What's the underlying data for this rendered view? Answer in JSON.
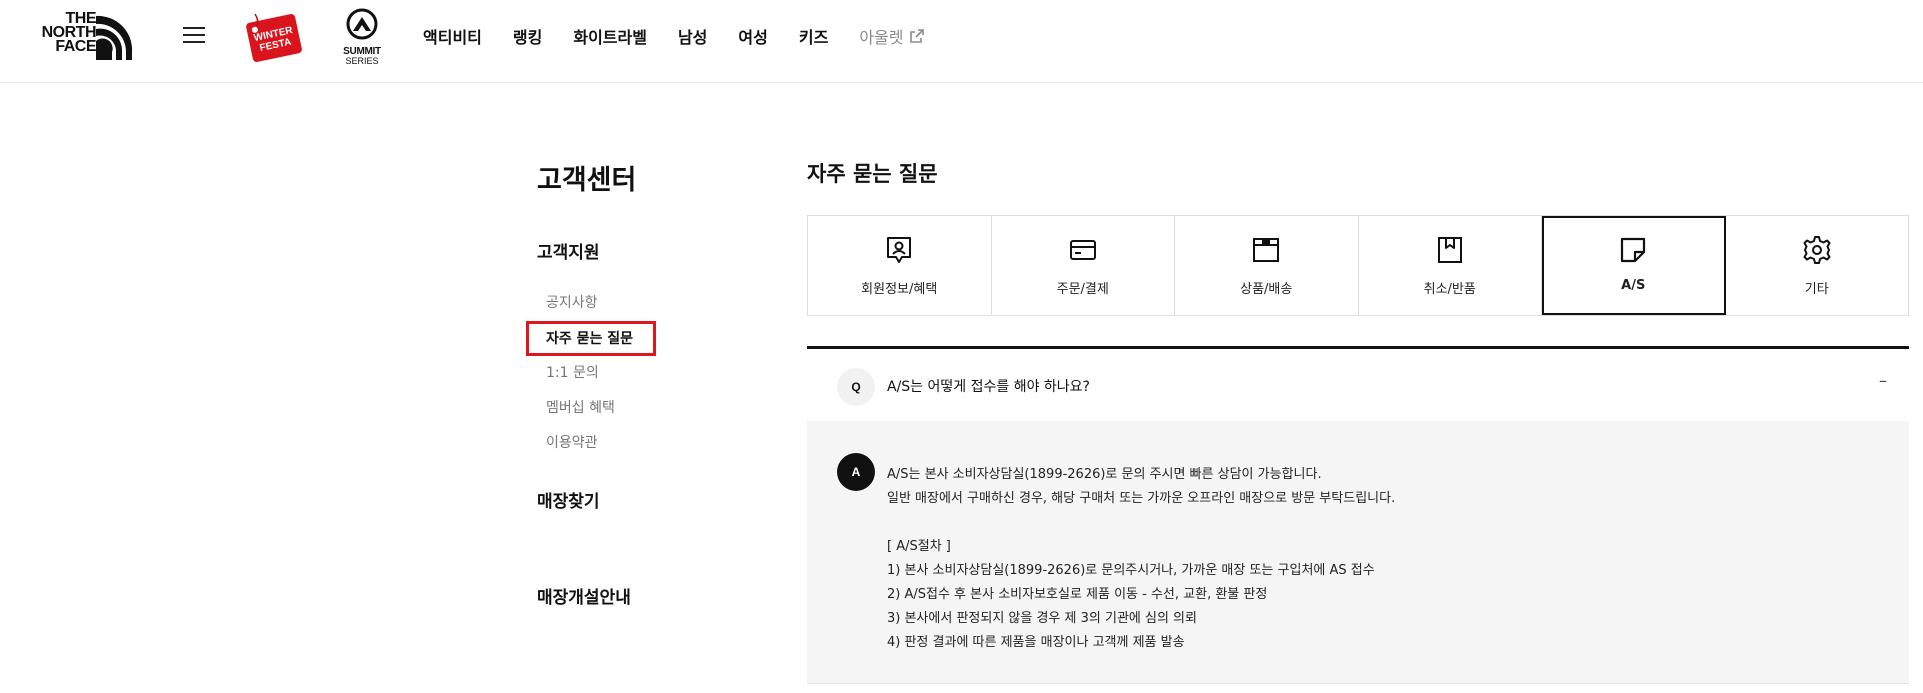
{
  "brand": {
    "logo_lines": [
      "THE",
      "NORTH",
      "FACE"
    ],
    "festa_badge": "WINTER FESTA",
    "summit_line1": "SUMMIT",
    "summit_line2": "SERIES"
  },
  "nav": {
    "items": [
      "액티비티",
      "랭킹",
      "화이트라벨",
      "남성",
      "여성",
      "키즈"
    ],
    "outlet": "아울렛"
  },
  "sidebar": {
    "title": "고객센터",
    "group_support": "고객지원",
    "links": [
      "공지사항",
      "자주 묻는 질문",
      "1:1 문의",
      "멤버십 혜택",
      "이용약관"
    ],
    "active_index": 1,
    "group_store": "매장찾기",
    "group_open": "매장개설안내"
  },
  "main": {
    "title": "자주 묻는 질문",
    "tabs": [
      {
        "label": "회원정보/혜택",
        "icon": "member-icon"
      },
      {
        "label": "주문/결제",
        "icon": "card-icon"
      },
      {
        "label": "상품/배송",
        "icon": "box-icon"
      },
      {
        "label": "취소/반품",
        "icon": "return-icon"
      },
      {
        "label": "A/S",
        "icon": "note-icon"
      },
      {
        "label": "기타",
        "icon": "gear-icon"
      }
    ],
    "active_tab": "A/S"
  },
  "faq": {
    "q_badge": "Q",
    "question": "A/S는 어떻게 접수를 해야 하나요?",
    "toggle": "–",
    "a_badge": "A",
    "answer_lines": [
      "A/S는 본사 소비자상담실(1899-2626)로 문의 주시면 빠른 상담이 가능합니다.",
      "일반 매장에서 구매하신 경우, 해당 구매처 또는 가까운 오프라인 매장으로 방문 부탁드립니다.",
      "",
      "[ A/S절차 ]",
      "1) 본사 소비자상담실(1899-2626)로 문의주시거나, 가까운 매장 또는 구입처에 AS 접수",
      "2) A/S접수 후 본사 소비자보호실로 제품 이동 - 수선, 교환, 환불 판정",
      "3) 본사에서 판정되지 않을 경우 제 3의 기관에 심의 의뢰",
      "4) 판정 결과에 따른 제품을 매장이나 고객께 제품 발송"
    ]
  },
  "colors": {
    "accent_red": "#e0161e",
    "text_dark": "#111111",
    "text_muted": "#777777",
    "answer_bg": "#f5f5f5"
  }
}
